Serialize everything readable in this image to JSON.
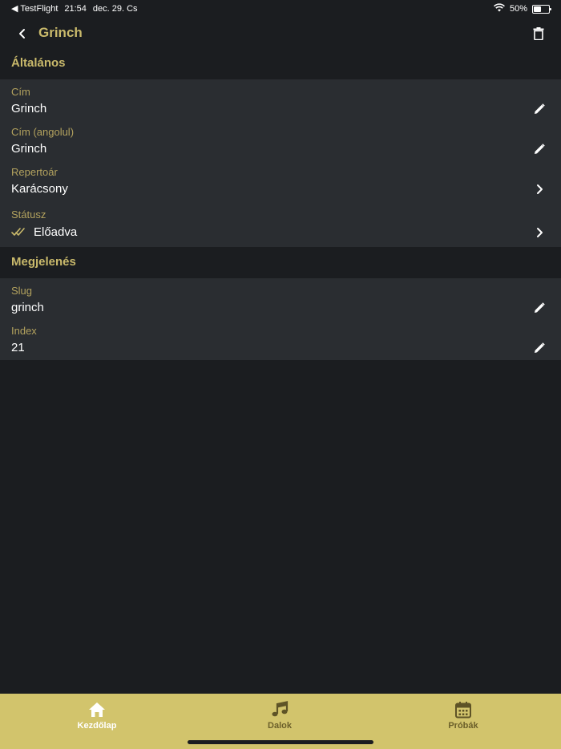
{
  "status_bar": {
    "back_app": "◀ TestFlight",
    "time": "21:54",
    "date": "dec. 29. Cs",
    "battery_text": "50%",
    "battery_level": 0.5
  },
  "navbar": {
    "title": "Grinch"
  },
  "sections": {
    "general": {
      "title": "Általános",
      "rows": [
        {
          "label": "Cím",
          "value": "Grinch"
        },
        {
          "label": "Cím (angolul)",
          "value": "Grinch"
        },
        {
          "label": "Repertoár",
          "value": "Karácsony"
        },
        {
          "label": "Státusz",
          "value": "Előadva"
        }
      ]
    },
    "appearance": {
      "title": "Megjelenés",
      "rows": [
        {
          "label": "Slug",
          "value": "grinch"
        },
        {
          "label": "Index",
          "value": "21"
        }
      ]
    }
  },
  "tabbar": {
    "tabs": [
      {
        "label": "Kezdőlap",
        "icon": "home-icon",
        "active": true
      },
      {
        "label": "Dalok",
        "icon": "music-note-icon",
        "active": false
      },
      {
        "label": "Próbák",
        "icon": "calendar-icon",
        "active": false
      }
    ]
  },
  "colors": {
    "accent": "#c9b96b",
    "background": "#1b1d20",
    "group_background": "#2a2d31",
    "tabbar": "#d2c46c"
  }
}
